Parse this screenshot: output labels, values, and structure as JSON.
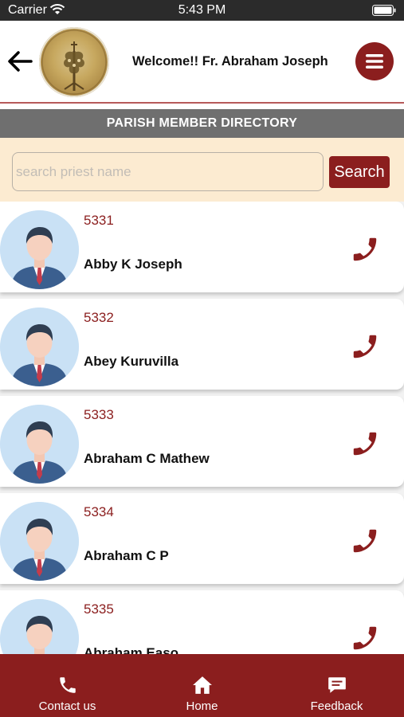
{
  "status_bar": {
    "carrier": "Carrier",
    "time": "5:43 PM"
  },
  "header": {
    "welcome": "Welcome!! Fr. Abraham Joseph"
  },
  "section_title": "PARISH MEMBER DIRECTORY",
  "search": {
    "placeholder": "search priest name",
    "value": "",
    "button_label": "Search"
  },
  "members": [
    {
      "id": "5331",
      "name": "Abby K Joseph"
    },
    {
      "id": "5332",
      "name": "Abey Kuruvilla"
    },
    {
      "id": "5333",
      "name": "Abraham C Mathew"
    },
    {
      "id": "5334",
      "name": "Abraham C P"
    },
    {
      "id": "5335",
      "name": "Abraham Easo"
    }
  ],
  "bottom_nav": [
    {
      "label": "Contact us",
      "icon": "phone-icon"
    },
    {
      "label": "Home",
      "icon": "home-icon"
    },
    {
      "label": "Feedback",
      "icon": "feedback-icon"
    }
  ],
  "colors": {
    "accent": "#8b1e1e",
    "section_bar": "#6f6f6f",
    "search_bg": "#fcebd1"
  }
}
